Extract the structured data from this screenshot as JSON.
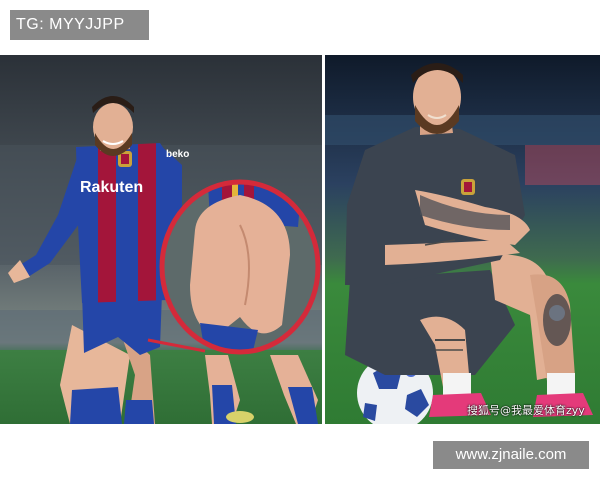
{
  "watermark_top": "TG: MYYJJPP",
  "left_photo": {
    "shirt_sponsor": "Rakuten",
    "shirt_sleeve": "beko"
  },
  "right_photo": {
    "caption": "搜狐号@我最爱体育zyy"
  },
  "watermark_bottom": "www.zjnaile.com",
  "colors": {
    "jersey_blue": "#2446a8",
    "jersey_red": "#a3153a",
    "highlight_circle": "#d42a3a",
    "pitch_green": "#3a8a3c",
    "training_shirt": "#3b4450"
  }
}
